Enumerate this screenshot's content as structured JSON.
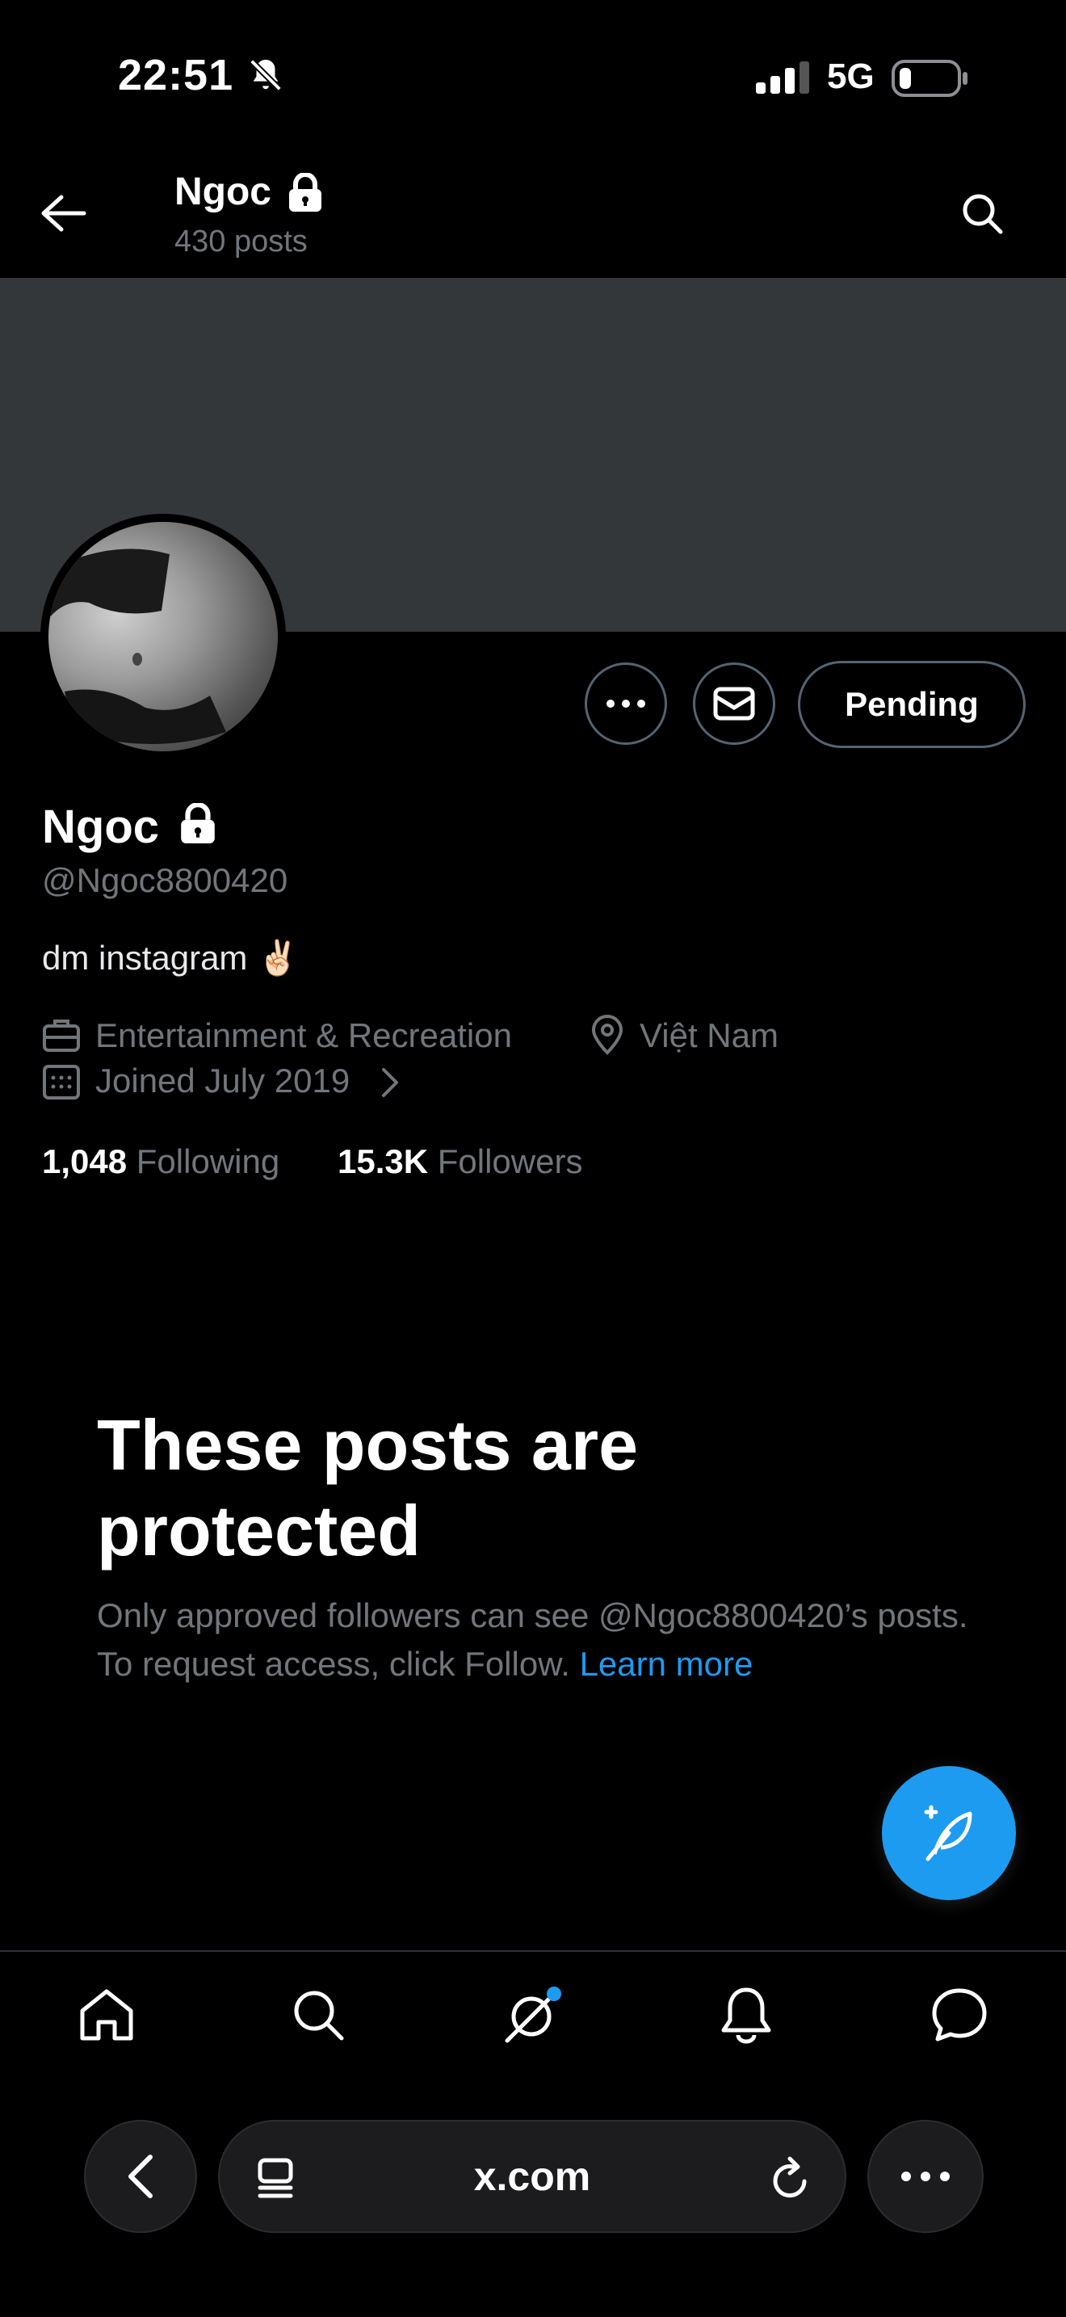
{
  "status_bar": {
    "time": "22:51",
    "network": "5G",
    "icons": [
      "bell-slash-icon",
      "signal-icon",
      "battery-icon"
    ]
  },
  "header": {
    "name": "Ngoc",
    "posts_count": "430 posts",
    "icons": [
      "back-arrow-icon",
      "lock-icon",
      "search-icon"
    ]
  },
  "profile": {
    "name": "Ngoc",
    "handle": "@Ngoc8800420",
    "bio": "dm instagram ✌🏻",
    "category": "Entertainment & Recreation",
    "location": "Việt Nam",
    "joined": "Joined July 2019",
    "following_count": "1,048",
    "following_label": "Following",
    "followers_count": "15.3K",
    "followers_label": "Followers"
  },
  "actions": {
    "pending_label": "Pending",
    "icons": [
      "more-icon",
      "message-icon"
    ]
  },
  "protected": {
    "title": "These posts are protected",
    "body": "Only approved followers can see @Ngoc8800420’s posts. To request access, click Follow.",
    "link": "Learn more"
  },
  "nav": {
    "items": [
      "home-icon",
      "search-icon",
      "grok-icon",
      "notifications-icon",
      "messages-icon"
    ]
  },
  "browser": {
    "url": "x.com",
    "icons": [
      "back-chevron-icon",
      "tabs-icon",
      "reload-icon",
      "more-icon"
    ]
  },
  "colors": {
    "background": "#000000",
    "banner": "#33373a",
    "accent": "#1d9bf0",
    "muted_text": "#71767b",
    "border": "#536471"
  }
}
